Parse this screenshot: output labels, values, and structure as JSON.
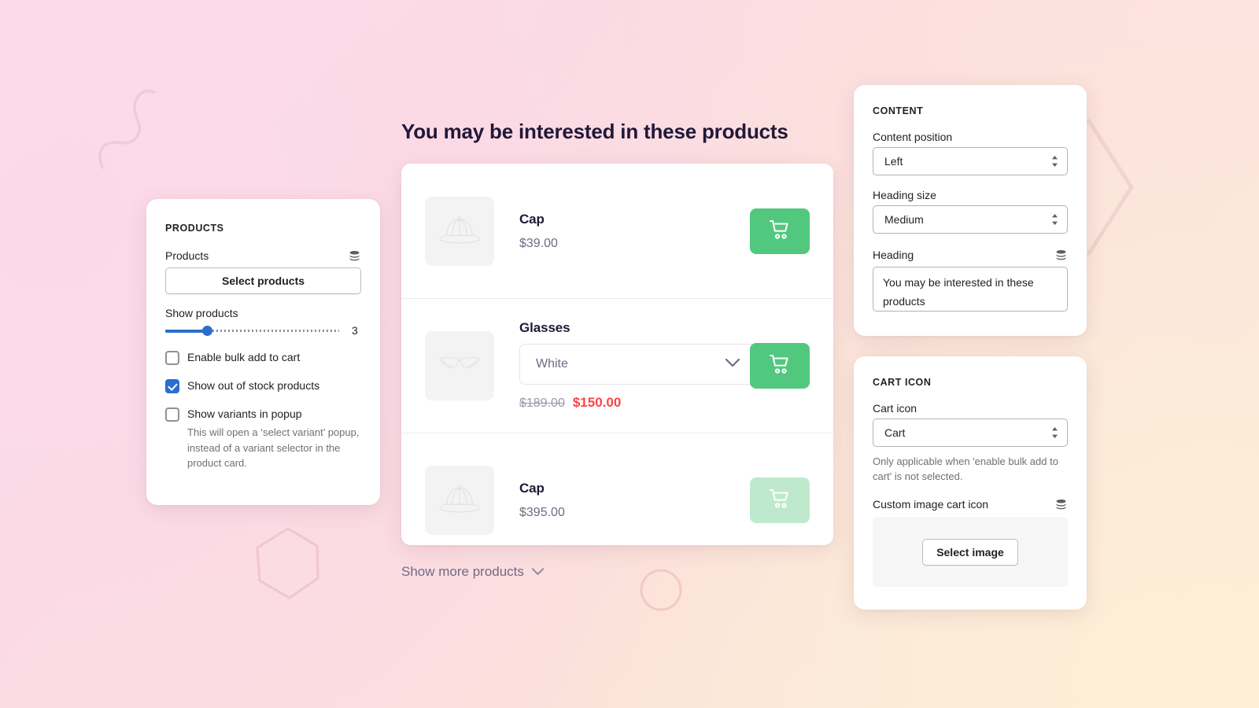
{
  "products_panel": {
    "section_title": "PRODUCTS",
    "products_label": "Products",
    "select_products_button": "Select products",
    "show_products_label": "Show products",
    "slider_value": "3",
    "checkboxes": [
      {
        "label": "Enable bulk add to cart",
        "checked": false,
        "help": ""
      },
      {
        "label": "Show out of stock products",
        "checked": true,
        "help": ""
      },
      {
        "label": "Show variants in popup",
        "checked": false,
        "help": "This will open a ‘select variant’ popup, instead of a variant selector in the product card."
      }
    ]
  },
  "preview": {
    "heading": "You may be interested in these products",
    "show_more_label": "Show more products",
    "products": [
      {
        "title": "Cap",
        "price": "$39.00",
        "thumb_icon": "cap-icon",
        "cart_state": "enabled"
      },
      {
        "title": "Glasses",
        "variant": "White",
        "price_old": "$189.00",
        "price_sale": "$150.00",
        "thumb_icon": "glasses-icon",
        "cart_state": "enabled"
      },
      {
        "title": "Cap",
        "price": "$395.00",
        "thumb_icon": "cap-icon",
        "cart_state": "disabled"
      }
    ]
  },
  "content_panel": {
    "section_title": "CONTENT",
    "content_position_label": "Content position",
    "content_position_value": "Left",
    "heading_size_label": "Heading size",
    "heading_size_value": "Medium",
    "heading_label": "Heading",
    "heading_value": "You may be interested in these products"
  },
  "cart_icon_panel": {
    "section_title": "CART ICON",
    "cart_icon_label": "Cart icon",
    "cart_icon_value": "Cart",
    "note": "Only applicable when 'enable bulk add to cart' is not selected.",
    "custom_image_label": "Custom image cart icon",
    "select_image_button": "Select image"
  },
  "colors": {
    "accent_green": "#52c87f",
    "accent_green_disabled": "#bfe9cd",
    "accent_blue": "#2c6ecb",
    "sale_red": "#fb4444",
    "heading_purple": "#221838",
    "bg_pink": "#fbdde9",
    "bg_cream": "#fdeed8"
  }
}
